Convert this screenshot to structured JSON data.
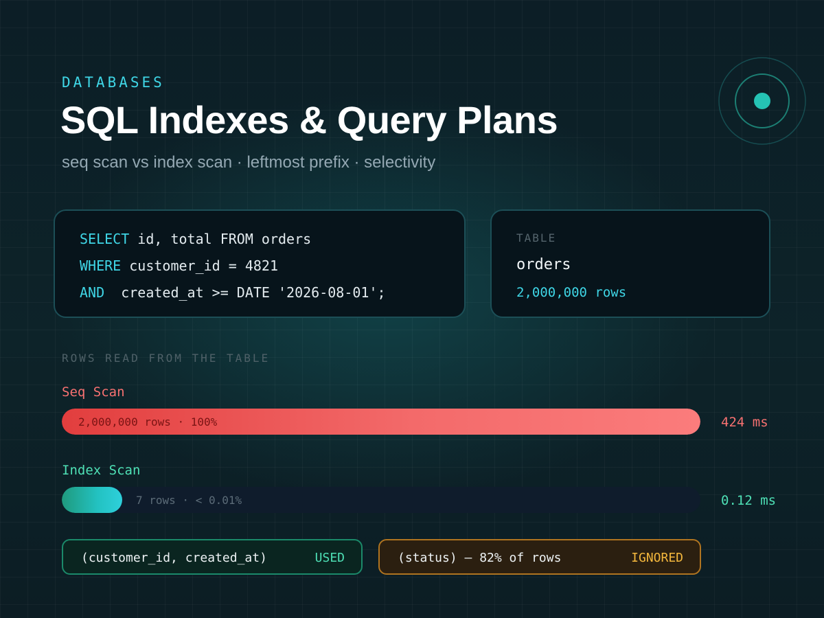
{
  "header": {
    "category": "DATABASES",
    "title": "SQL Indexes & Query Plans",
    "subtitle": "seq scan vs index scan · leftmost prefix · selectivity"
  },
  "query": {
    "line1": {
      "keyword": "SELECT",
      "rest": " id, total FROM orders"
    },
    "line2": {
      "keyword": "WHERE",
      "rest": " customer_id = 4821"
    },
    "line3": {
      "keyword": "AND",
      "rest": "  created_at >= DATE '2026-08-01';"
    }
  },
  "table_info": {
    "label": "TABLE",
    "name": "orders",
    "rows": "2,000,000 rows"
  },
  "rows_read": {
    "section_label": "ROWS READ FROM THE TABLE",
    "seq_scan": {
      "label": "Seq Scan",
      "bar_text": "2,000,000 rows · 100%",
      "fraction": 1.0,
      "time": "424 ms"
    },
    "index_scan": {
      "label": "Index Scan",
      "bar_text": "7 rows · < 0.01%",
      "fraction": 0.0001,
      "time": "0.12 ms"
    }
  },
  "indexes": [
    {
      "name": "(customer_id, created_at)",
      "status": "USED"
    },
    {
      "name": "(status) — 82% of rows",
      "status": "IGNORED"
    }
  ],
  "colors": {
    "accent": "#3fd6e6",
    "seq": "#f87171",
    "index": "#4ee0b5",
    "ignored": "#f5b83d"
  }
}
